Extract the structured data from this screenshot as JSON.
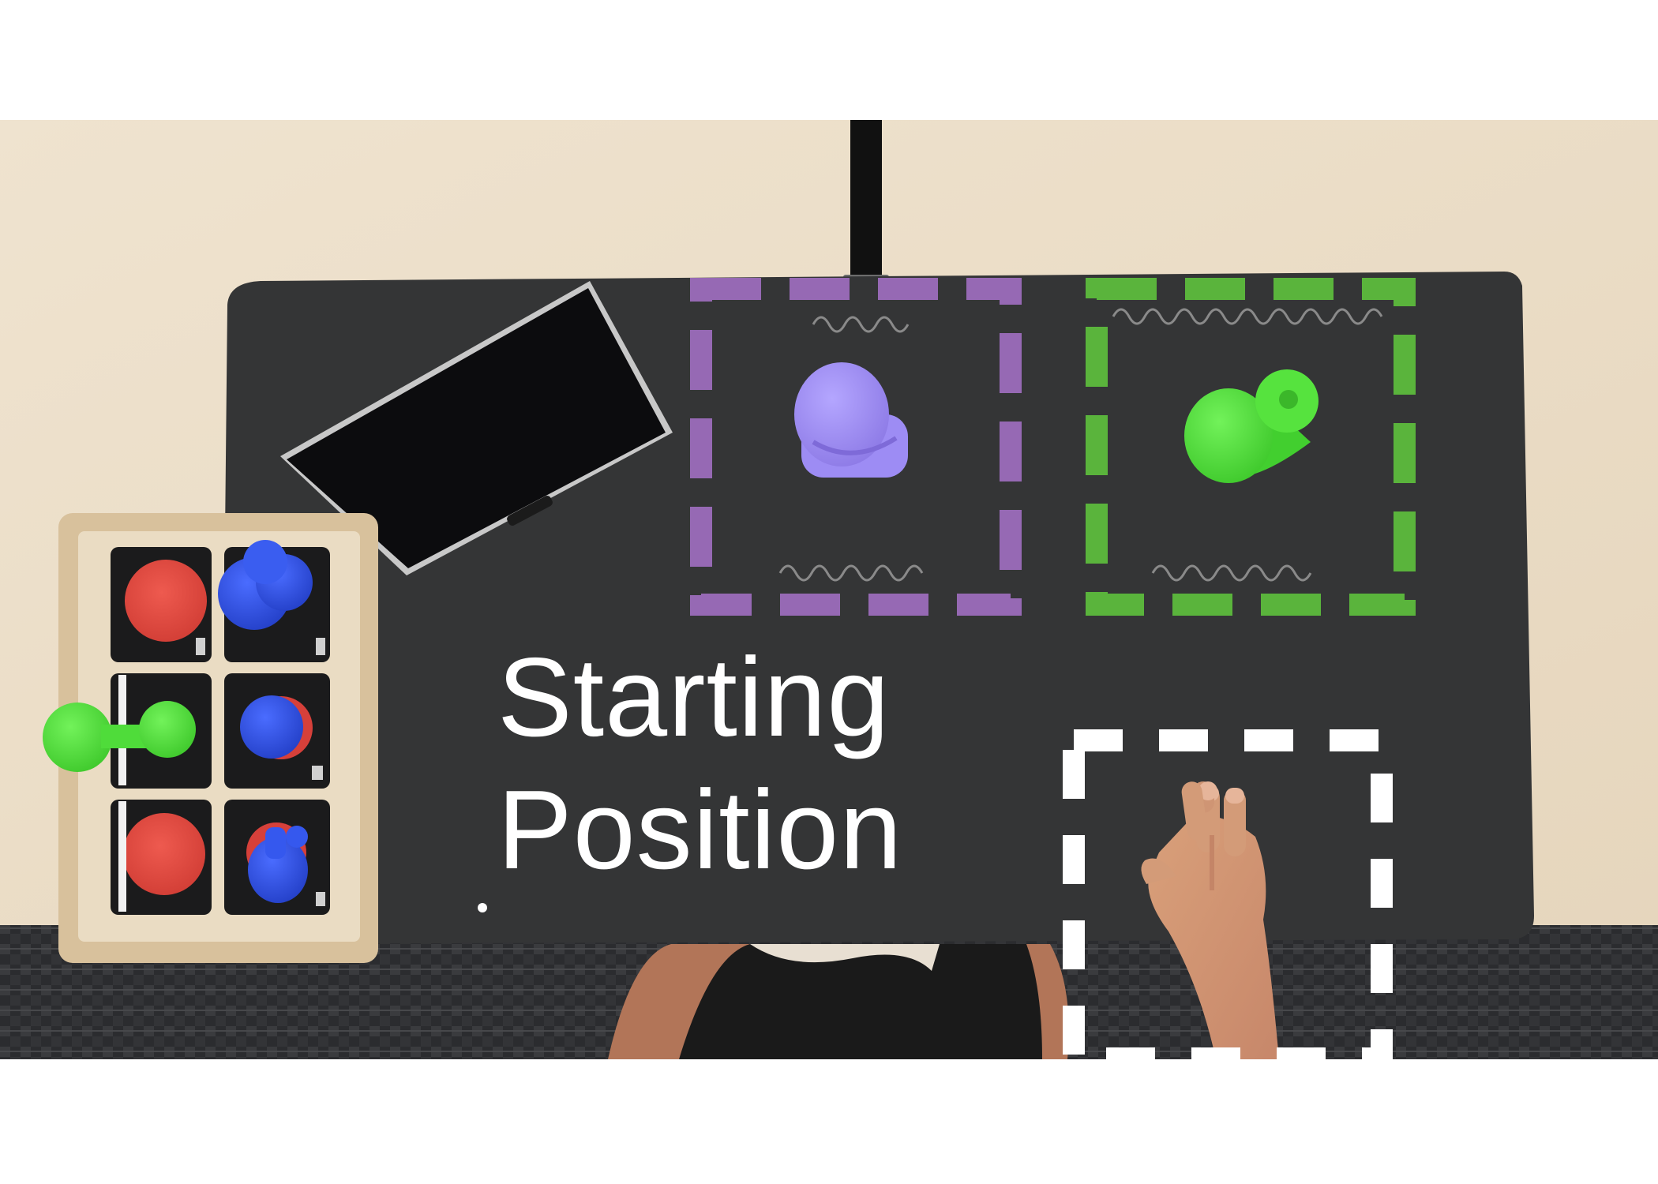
{
  "caption": {
    "line1": "Starting",
    "line2": "Position"
  },
  "colors": {
    "purple_zone": "#9669b4",
    "green_zone": "#5ab43c",
    "start_zone": "#ffffff",
    "mat": "#343536",
    "table": "#ede1cc",
    "carpet": "#2a2b2d",
    "purple_object": "#9a88f2",
    "green_object": "#4fe03a",
    "red_token": "#e0433a",
    "blue_object": "#2f50e0"
  },
  "icons": {
    "purple_zone": "dashed-square-outline",
    "green_zone": "dashed-square-outline",
    "start_zone": "dashed-square-outline",
    "zone_edge_marks": "wavy-line"
  }
}
